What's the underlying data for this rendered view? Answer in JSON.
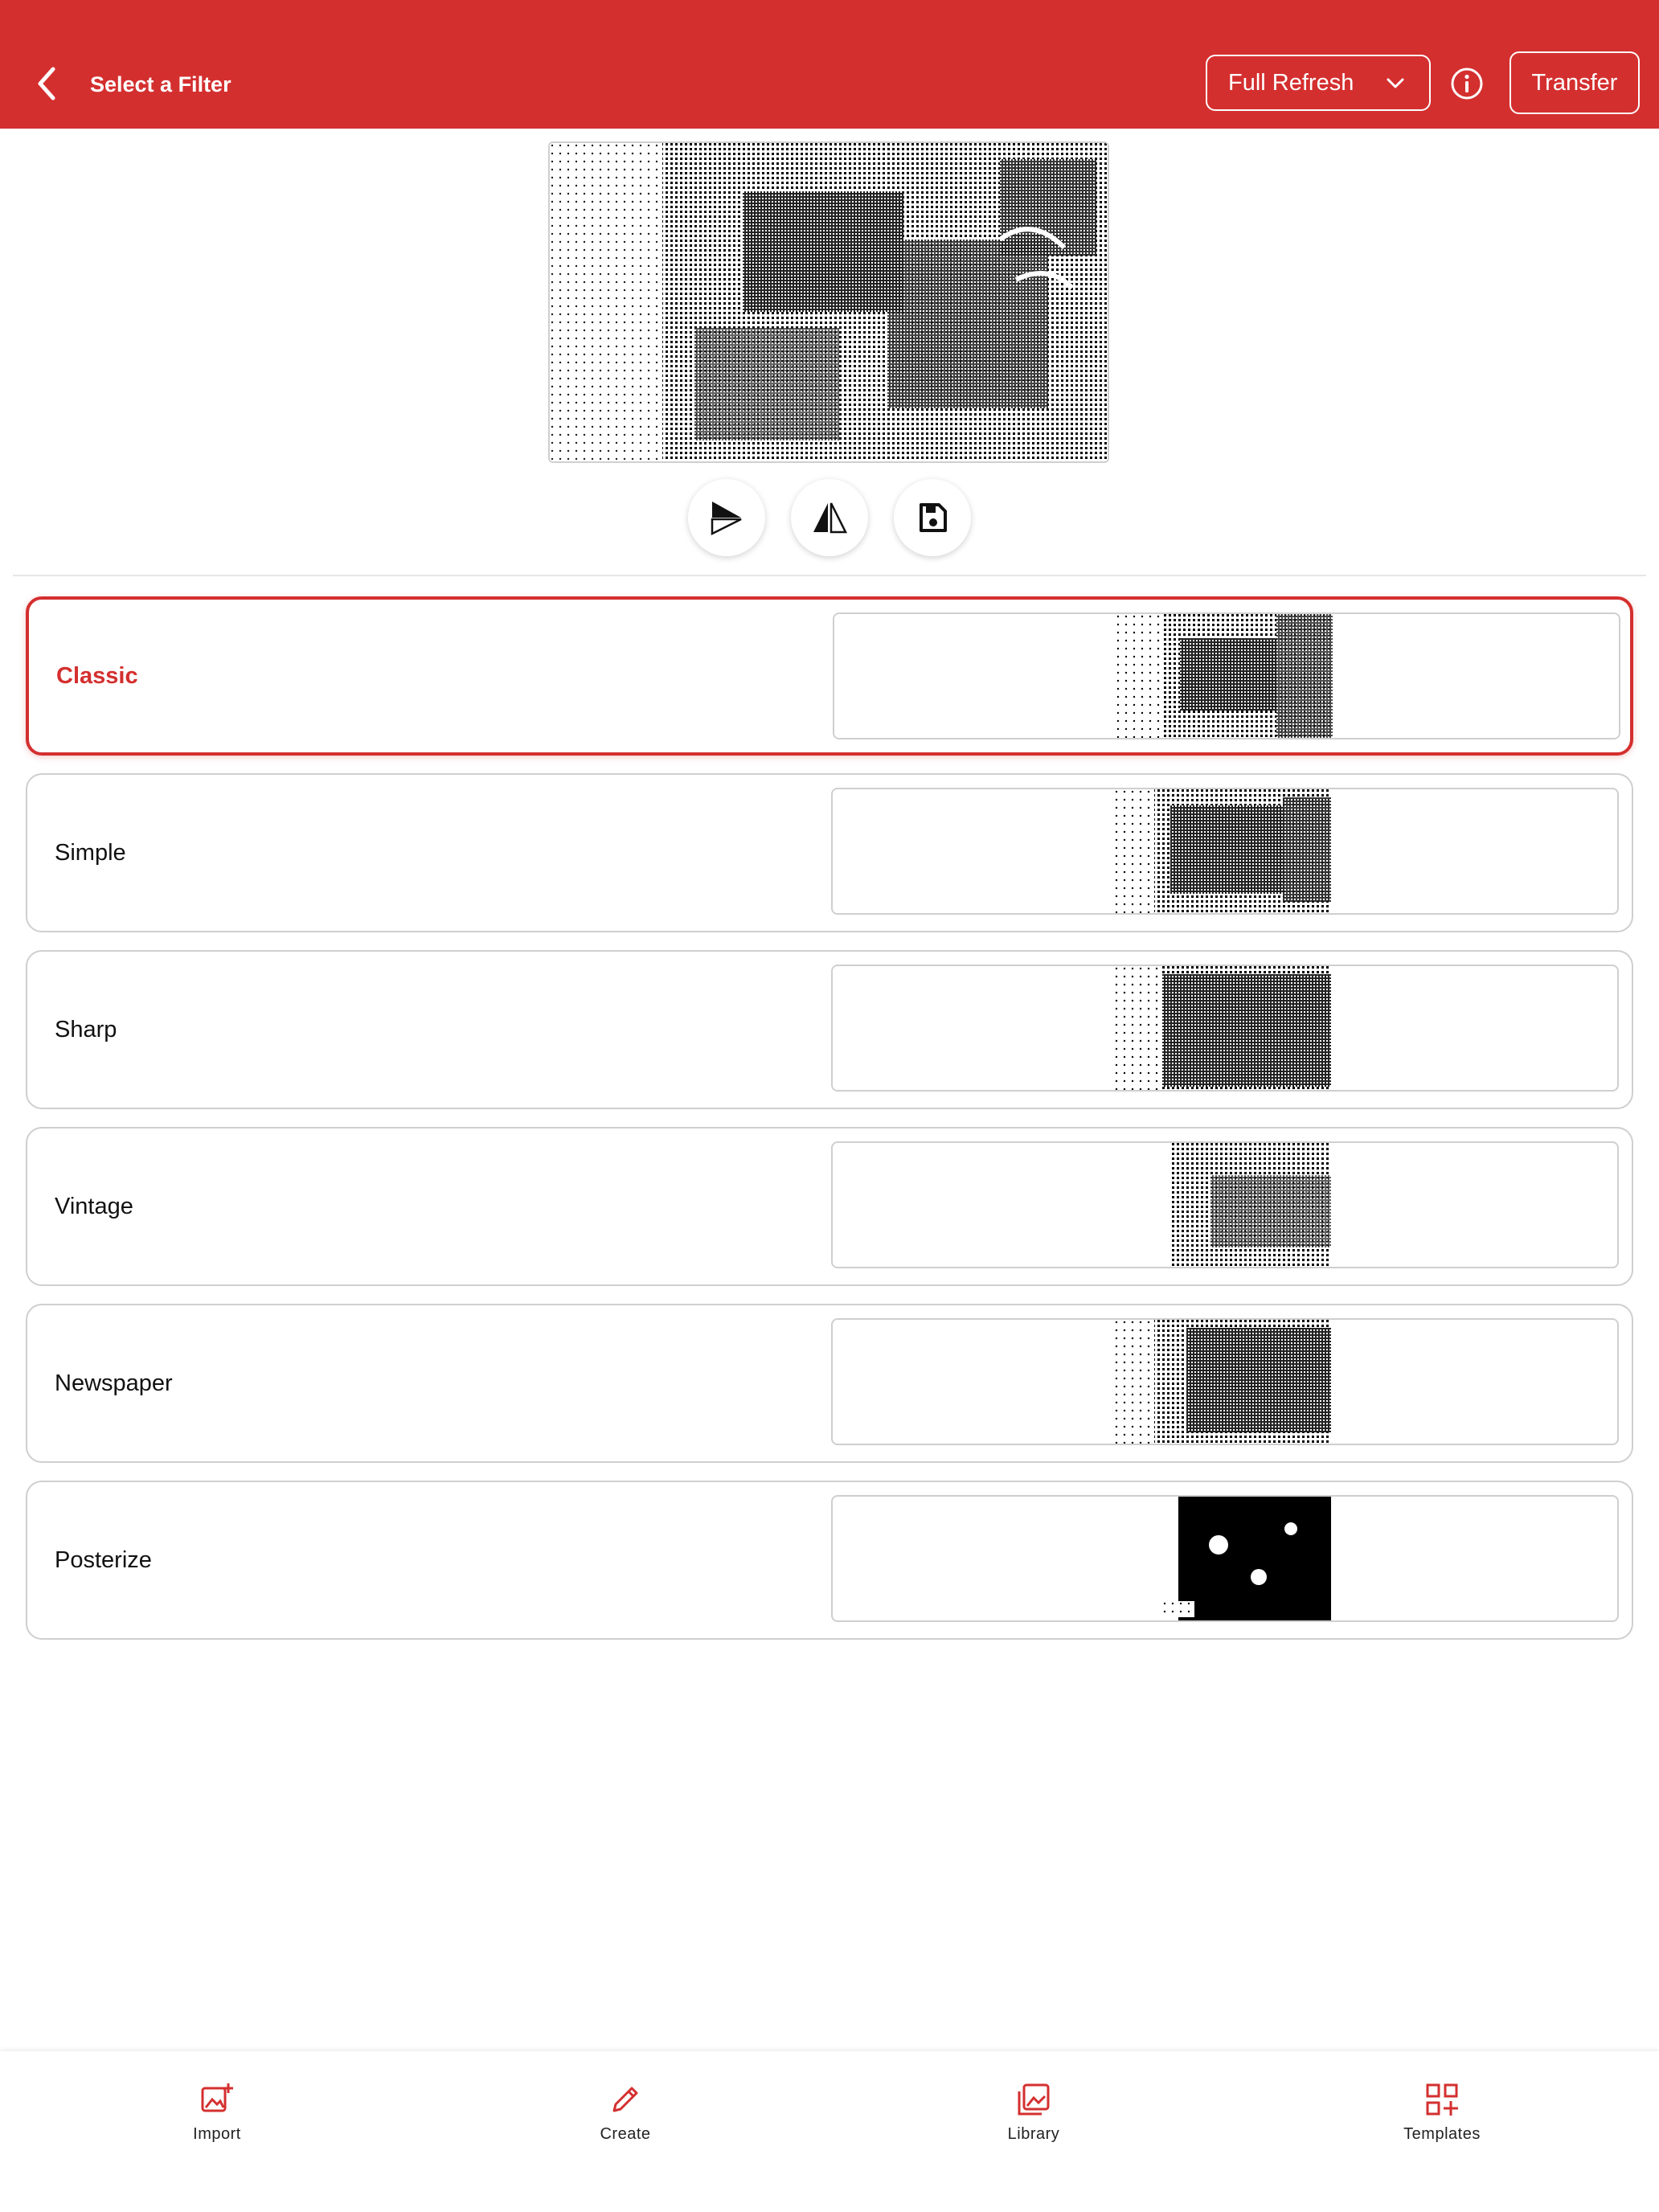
{
  "header": {
    "title": "Select a Filter",
    "refresh_mode": "Full Refresh",
    "transfer_label": "Transfer"
  },
  "tools": {
    "icons": [
      "rotate-icon",
      "flip-icon",
      "save-icon"
    ]
  },
  "filters": [
    {
      "label": "Classic",
      "selected": true
    },
    {
      "label": "Simple",
      "selected": false
    },
    {
      "label": "Sharp",
      "selected": false
    },
    {
      "label": "Vintage",
      "selected": false
    },
    {
      "label": "Newspaper",
      "selected": false
    },
    {
      "label": "Posterize",
      "selected": false
    }
  ],
  "bottom_nav": [
    {
      "label": "Import",
      "icon": "image-add-icon"
    },
    {
      "label": "Create",
      "icon": "pencil-icon"
    },
    {
      "label": "Library",
      "icon": "gallery-icon"
    },
    {
      "label": "Templates",
      "icon": "grid-add-icon"
    }
  ],
  "colors": {
    "accent": "#d42f2f",
    "border": "#cfcfcf"
  }
}
